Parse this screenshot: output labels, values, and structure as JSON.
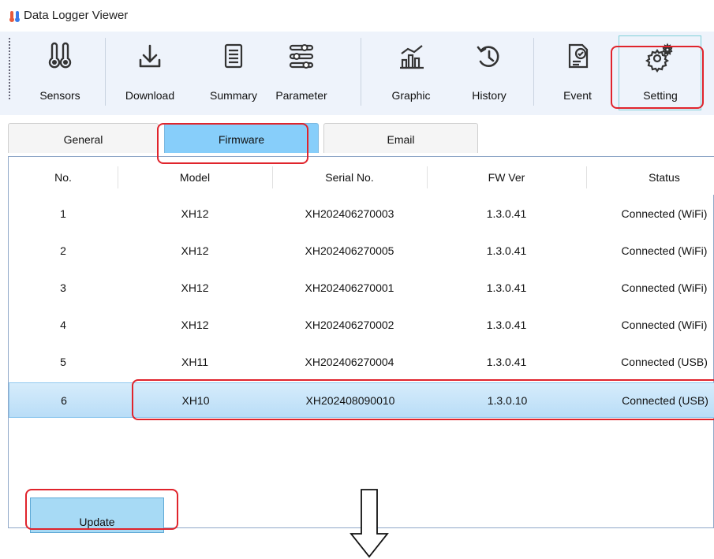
{
  "window": {
    "title": "Data Logger Viewer"
  },
  "toolbar": {
    "buttons": [
      {
        "label": "Sensors",
        "icon": "thermometers-icon"
      },
      {
        "label": "Download",
        "icon": "download-icon"
      },
      {
        "label": "Summary",
        "icon": "document-list-icon"
      },
      {
        "label": "Parameter",
        "icon": "sliders-icon"
      },
      {
        "label": "Graphic",
        "icon": "bar-line-chart-icon"
      },
      {
        "label": "History",
        "icon": "history-icon"
      },
      {
        "label": "Event",
        "icon": "event-checklist-icon"
      },
      {
        "label": "Setting",
        "icon": "gear-icon"
      }
    ]
  },
  "tabs": [
    {
      "label": "General",
      "active": false
    },
    {
      "label": "Firmware",
      "active": true
    },
    {
      "label": "Email",
      "active": false
    }
  ],
  "table": {
    "columns": [
      "No.",
      "Model",
      "Serial No.",
      "FW Ver",
      "Status"
    ],
    "rows": [
      [
        "1",
        "XH12",
        "XH202406270003",
        "1.3.0.41",
        "Connected (WiFi)"
      ],
      [
        "2",
        "XH12",
        "XH202406270005",
        "1.3.0.41",
        "Connected (WiFi)"
      ],
      [
        "3",
        "XH12",
        "XH202406270001",
        "1.3.0.41",
        "Connected (WiFi)"
      ],
      [
        "4",
        "XH12",
        "XH202406270002",
        "1.3.0.41",
        "Connected (WiFi)"
      ],
      [
        "5",
        "XH11",
        "XH202406270004",
        "1.3.0.41",
        "Connected (USB)"
      ],
      [
        "6",
        "XH10",
        "XH202408090010",
        "1.3.0.10",
        "Connected (USB)"
      ]
    ],
    "selected_row": 6
  },
  "actions": {
    "update_label": "Update"
  },
  "colors": {
    "toolbar_bg": "#eef3fb",
    "active_tab": "#87cefa",
    "selected_row": "#c6e4f8",
    "highlight": "#e0242c"
  }
}
